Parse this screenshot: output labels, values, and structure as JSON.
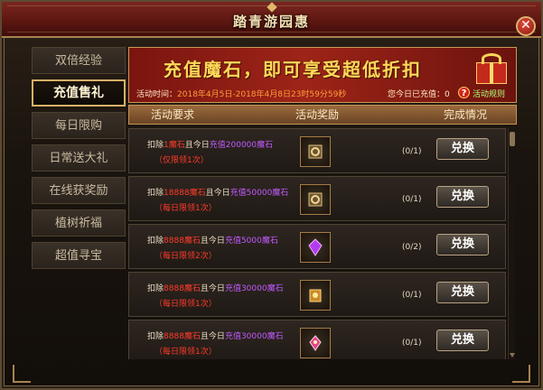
{
  "window": {
    "title": "踏青游园惠",
    "close_symbol": "✕"
  },
  "sidebar": {
    "items": [
      {
        "label": "双倍经验"
      },
      {
        "label": "充值售礼"
      },
      {
        "label": "每日限购"
      },
      {
        "label": "日常送大礼"
      },
      {
        "label": "在线获奖励"
      },
      {
        "label": "植树祈福"
      },
      {
        "label": "超值寻宝"
      }
    ]
  },
  "banner": {
    "title": "充值魔石，即可享受超低折扣",
    "time_prefix": "活动时间：",
    "time_range": "2018年4月5日-2018年4月8日23时59分59秒",
    "today_label": "您今日已充值：0",
    "help_symbol": "?",
    "help_label": "活动规则"
  },
  "table": {
    "headers": [
      "活动要求",
      "活动奖励",
      "完成情况"
    ]
  },
  "rows": [
    {
      "req_a": "扣除",
      "req_cost": "1魔石",
      "req_b": "且今日",
      "req_charge": "充值200000魔石",
      "limit": "（仅限领1次）",
      "progress": "(0/1)",
      "button": "兑换",
      "icon": "ring-box-icon"
    },
    {
      "req_a": "扣除",
      "req_cost": "18888魔石",
      "req_b": "且今日",
      "req_charge": "充值50000魔石",
      "limit": "（每日限领1次）",
      "progress": "(0/1)",
      "button": "兑换",
      "icon": "ring-box-icon"
    },
    {
      "req_a": "扣除",
      "req_cost": "8888魔石",
      "req_b": "且今日",
      "req_charge": "充值5000魔石",
      "limit": "（每日限领2次）",
      "progress": "(0/2)",
      "button": "兑换",
      "icon": "purple-gem-icon"
    },
    {
      "req_a": "扣除",
      "req_cost": "8888魔石",
      "req_b": "且今日",
      "req_charge": "充值30000魔石",
      "limit": "（每日限领1次）",
      "progress": "(0/1)",
      "button": "兑换",
      "icon": "wing-scroll-icon"
    },
    {
      "req_a": "扣除",
      "req_cost": "8888魔石",
      "req_b": "且今日",
      "req_charge": "充值30000魔石",
      "limit": "（每日限领1次）",
      "progress": "(0/1)",
      "button": "兑换",
      "icon": "evolve-crystal-icon"
    }
  ],
  "colors": {
    "accent_gold": "#d8b067",
    "title_red": "#7a2620",
    "cost_red": "#ff3b2a",
    "charge_purple": "#c25bff"
  }
}
